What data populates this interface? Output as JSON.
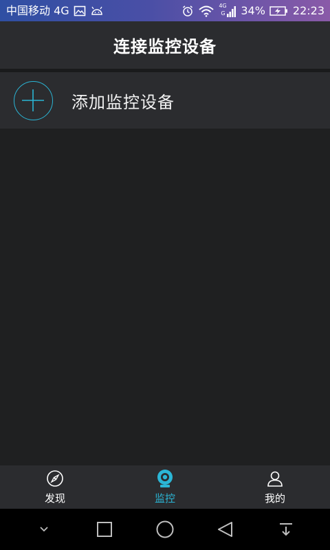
{
  "status_bar": {
    "carrier": "中国移动 4G",
    "battery_percent": "34%",
    "time": "22:23",
    "net_label_top": "4G",
    "net_label_bottom": "G",
    "icons": [
      "image-icon",
      "android-icon",
      "alarm-icon",
      "wifi-icon",
      "signal-icon",
      "battery-icon"
    ]
  },
  "header": {
    "title": "连接监控设备"
  },
  "add_device": {
    "label": "添加监控设备",
    "icon": "plus-circle-icon"
  },
  "tabs": [
    {
      "label": "发现",
      "icon": "compass-icon",
      "active": false
    },
    {
      "label": "监控",
      "icon": "camera-icon",
      "active": true
    },
    {
      "label": "我的",
      "icon": "person-icon",
      "active": false
    }
  ],
  "nav_bar": {
    "icons": [
      "chevron-down-icon",
      "recent-apps-icon",
      "home-icon",
      "back-icon",
      "notification-pull-icon"
    ]
  },
  "colors": {
    "accent": "#2bb6d6",
    "panel": "#2b2c2f",
    "background": "#1f2021"
  }
}
